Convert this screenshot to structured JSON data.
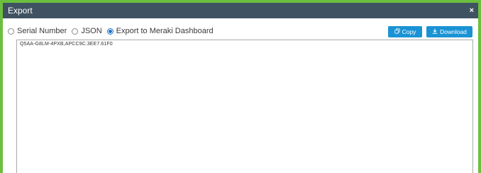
{
  "dialog": {
    "title": "Export",
    "close_label": "×"
  },
  "options": [
    {
      "label": "Serial Number",
      "checked": false
    },
    {
      "label": "JSON",
      "checked": false
    },
    {
      "label": "Export to Meraki Dashboard",
      "checked": true
    }
  ],
  "buttons": {
    "copy_label": "Copy",
    "copy_icon": "copy-icon",
    "download_label": "Download",
    "download_icon": "download-icon"
  },
  "output": {
    "text": "Q5AA-G8LM-4PXB,APCC9C.3EE7.61F0"
  },
  "colors": {
    "titlebar": "#3f5262",
    "border": "#6cbf3e",
    "button": "#1a93d4",
    "radio_selected": "#1a73c9"
  }
}
